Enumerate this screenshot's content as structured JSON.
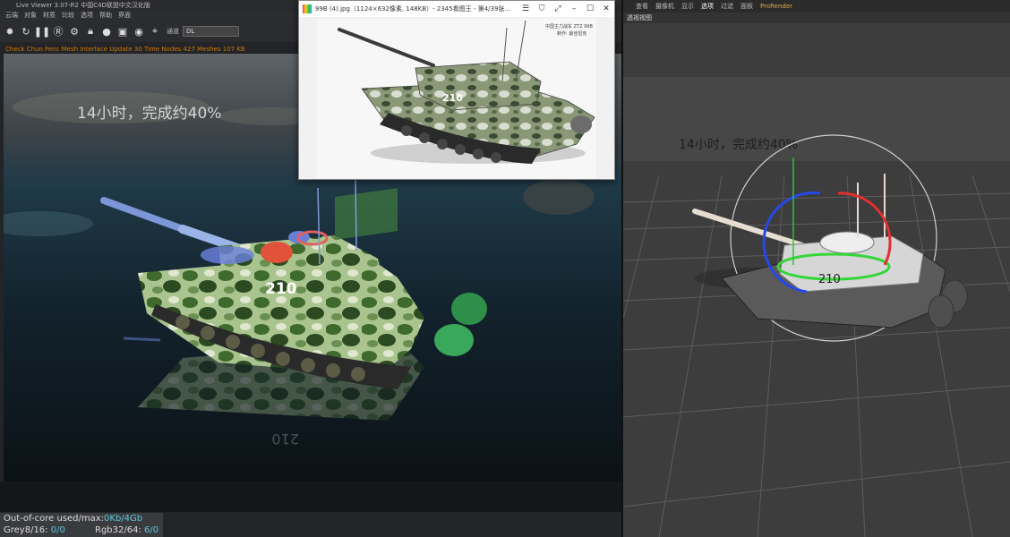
{
  "live_viewer": {
    "title": "Live Viewer 3.07-R2 中国C4D联盟中文汉化版",
    "menu": [
      "云端",
      "对象",
      "材质",
      "比较",
      "选项",
      "帮助",
      "界面"
    ],
    "toolbar_label": "通道",
    "channel_value": "DL",
    "status_line": "Check Chun Fenc Mesh Interlace Update 30 Time Nodes 427 Meshes 107 KB",
    "overlay_text": "14小时，完成约40%",
    "tank_number": "210",
    "stats": {
      "ooc_label": "Out-of-core used/max:",
      "ooc_value": "0Kb/4Gb",
      "grey_label": "Grey8/16:",
      "grey_value": "0/0",
      "rgb_label": "Rgb32/64:",
      "rgb_value": "6/0"
    }
  },
  "image_viewer": {
    "title": "99B (4).jpg（1124×632像素, 148KB）- 2345看图王 - 第4/39张...",
    "caption_line1": "中国主力战车 ZTZ 99B",
    "caption_line2": "制作: 最佳坦克",
    "tank_number": "210"
  },
  "c4d": {
    "menu": [
      "查看",
      "摄像机",
      "显示",
      "选项",
      "过滤",
      "面板",
      "ProRender"
    ],
    "viewport_label": "透视视图",
    "overlay_text": "14小时，完成约40%",
    "tank_number": "210"
  }
}
